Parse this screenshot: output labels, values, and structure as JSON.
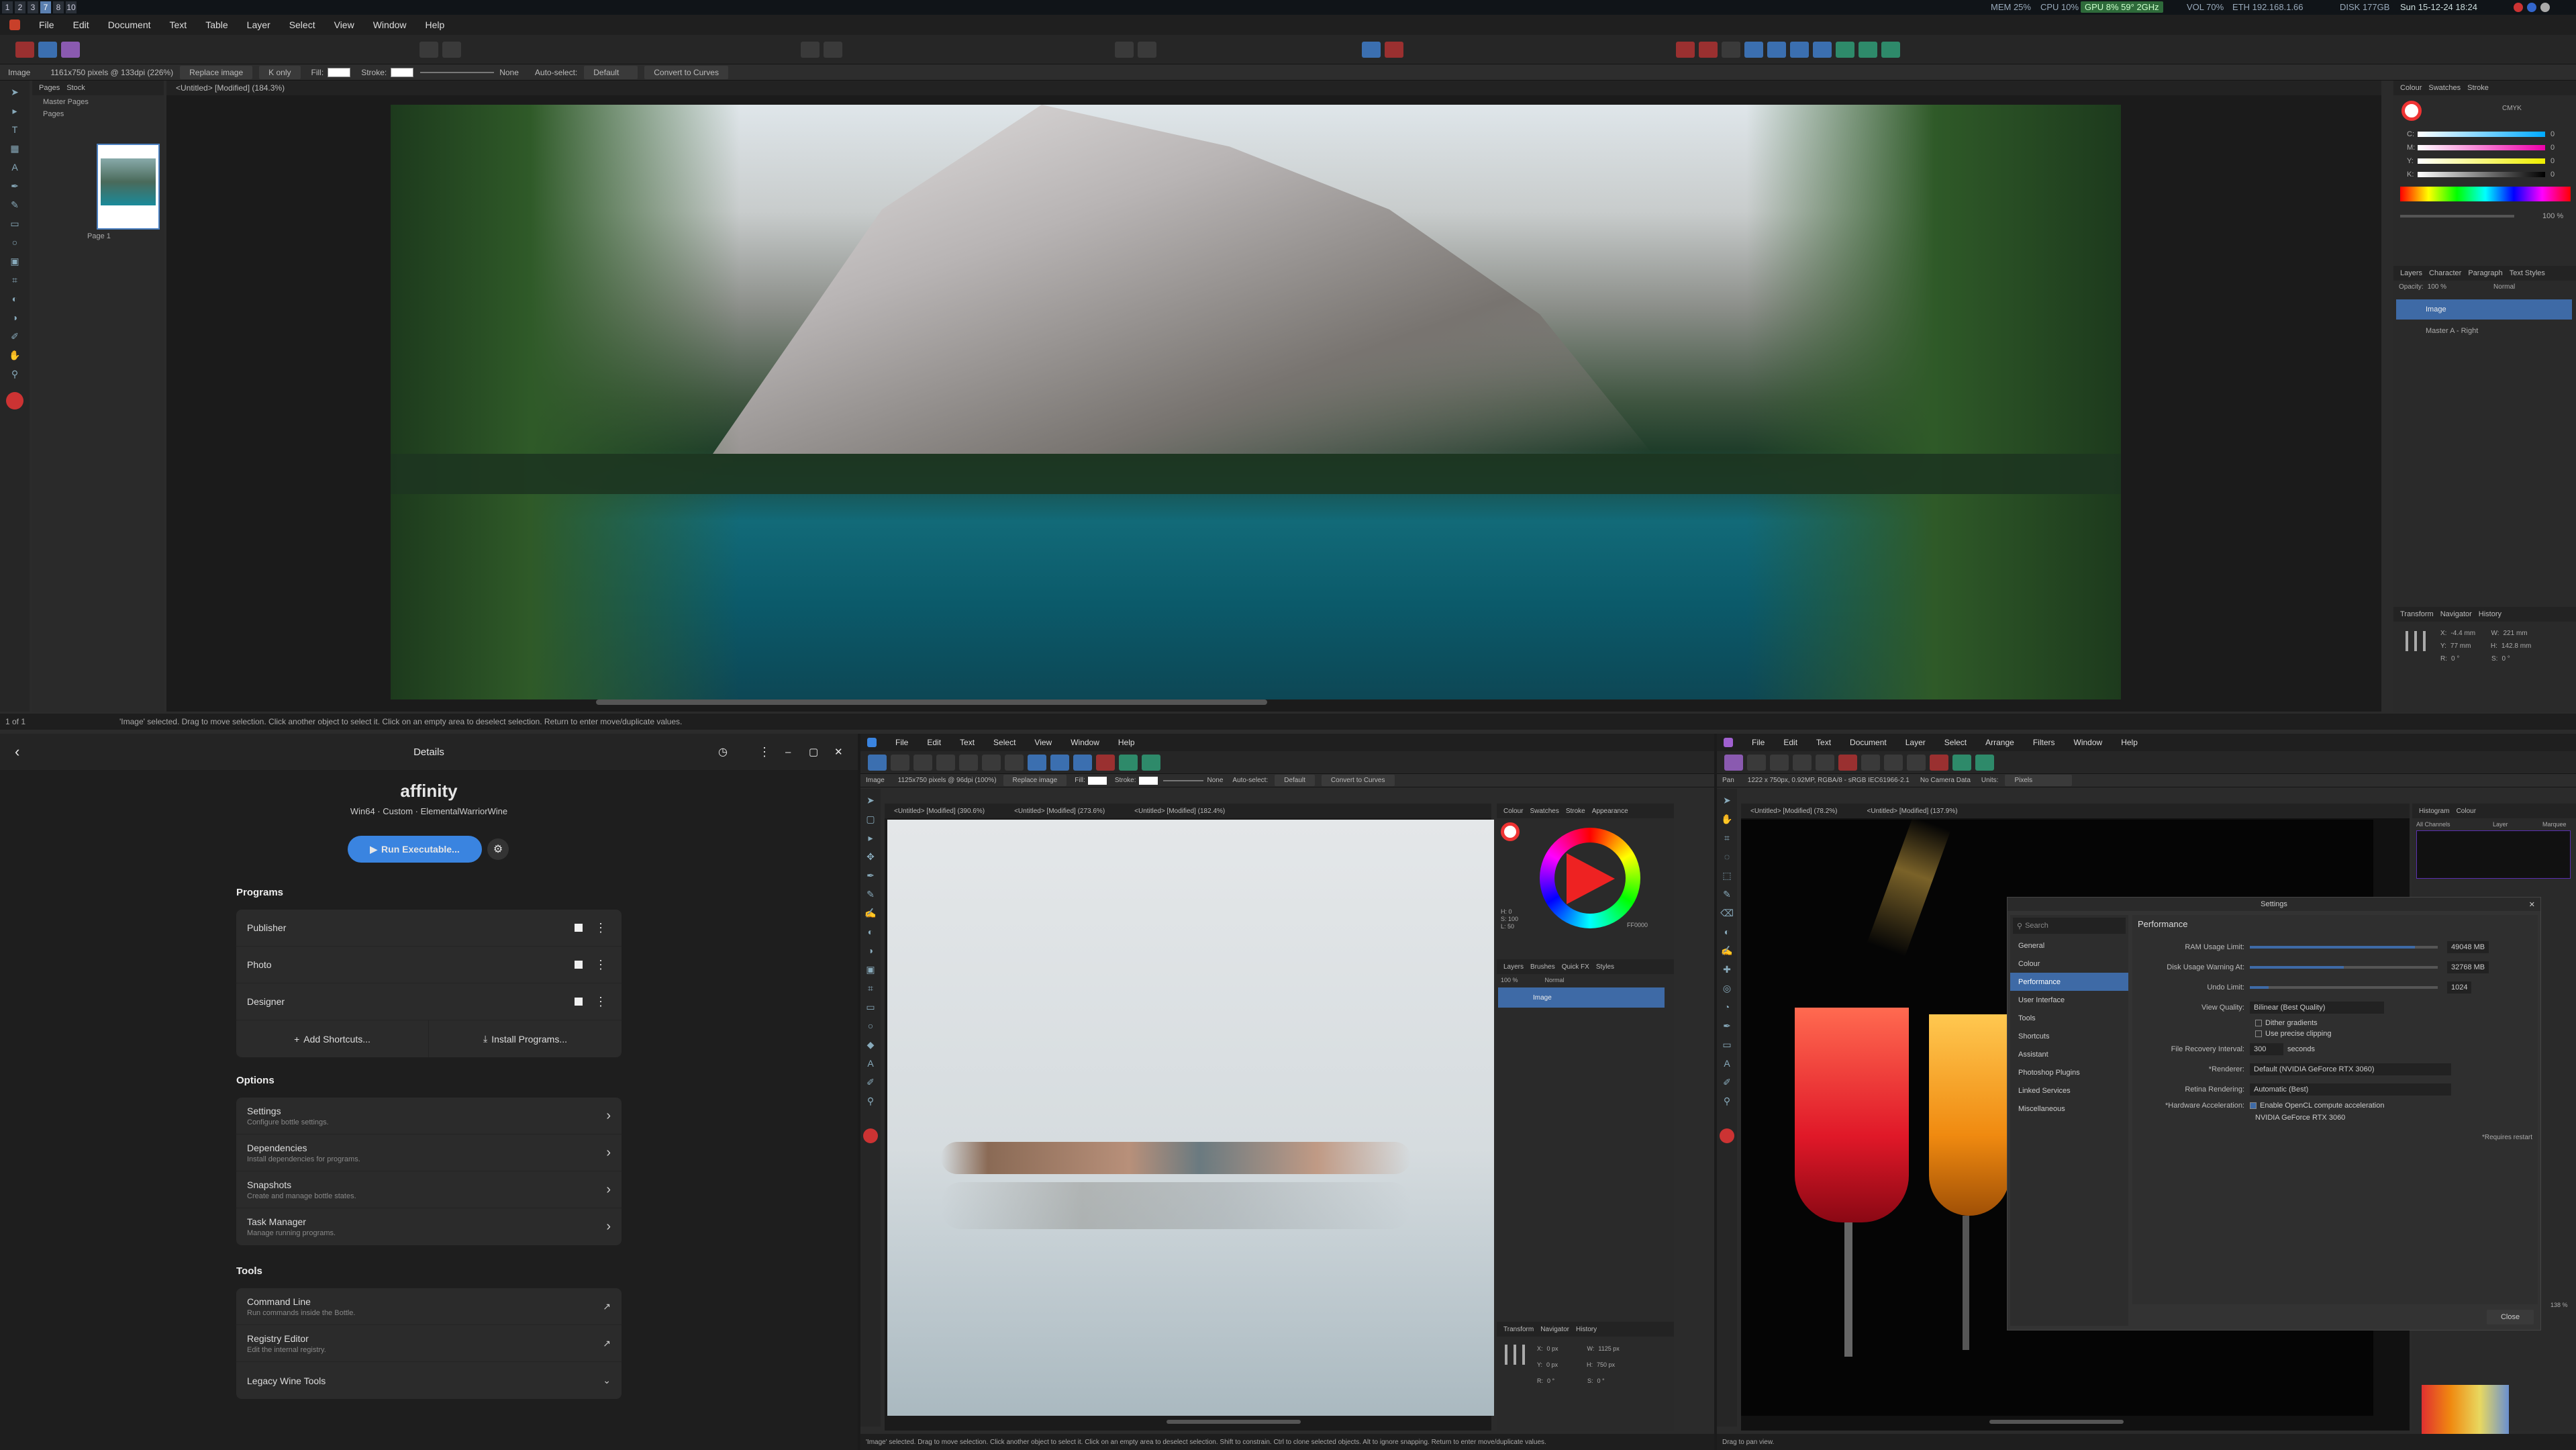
{
  "topbar": {
    "workspaces": [
      "1",
      "2",
      "3",
      "7",
      "8",
      "10"
    ],
    "mem": "MEM 25%",
    "cpu": "CPU 10%",
    "gpu": "GPU 8% 59° 2GHz",
    "vol": "VOL 70%",
    "eth": "ETH 192.168.1.66",
    "disk": "DISK 177GB",
    "clock": "Sun 15-12-24 18:24"
  },
  "win1": {
    "menu": [
      "File",
      "Edit",
      "Document",
      "Text",
      "Table",
      "Layer",
      "Select",
      "View",
      "Window",
      "Help"
    ],
    "ctx": {
      "label": "Image",
      "info": "1161x750 pixels @ 133dpi (226%)",
      "replace": "Replace image",
      "k": "K only",
      "fill": "Fill:",
      "stroke": "Stroke:",
      "none": "None",
      "autoselect": "Auto-select:",
      "default": "Default",
      "convert": "Convert to Curves"
    },
    "pages_tabs": [
      "Pages",
      "Stock"
    ],
    "master_pages": "Master Pages",
    "pages": "Pages",
    "page_label": "Page 1",
    "doc_tab": "<Untitled> [Modified] (184.3%)",
    "right_tabs": [
      "Colour",
      "Swatches",
      "Stroke"
    ],
    "colour_mode": "CMYK",
    "cmyk": [
      {
        "k": "C:",
        "v": "0"
      },
      {
        "k": "M:",
        "v": "0"
      },
      {
        "k": "Y:",
        "v": "0"
      },
      {
        "k": "K:",
        "v": "0"
      }
    ],
    "opacity_pct": "100 %",
    "layer_tabs": [
      "Layers",
      "Character",
      "Paragraph",
      "Text Styles"
    ],
    "layer_opacity_label": "Opacity:",
    "layer_opacity": "100 %",
    "layer_blend": "Normal",
    "layers": [
      {
        "name": "Image"
      },
      {
        "name": "Master A - Right"
      }
    ],
    "transform_tabs": [
      "Transform",
      "Navigator",
      "History"
    ],
    "transform": {
      "x": "-4.4 mm",
      "y": "77 mm",
      "w": "221 mm",
      "h": "142.8 mm",
      "r": "0 °",
      "s": "0 °"
    },
    "page_nav": "1 of 1",
    "status": "'Image' selected. Drag to move selection. Click another object to select it. Click on an empty area to deselect selection. Return to enter move/duplicate values."
  },
  "bottles": {
    "title": "Details",
    "app": "affinity",
    "subtitle": "Win64 · Custom · ElementalWarriorWine",
    "run": "Run Executable...",
    "programs_title": "Programs",
    "programs": [
      "Publisher",
      "Photo",
      "Designer"
    ],
    "add_shortcuts": "Add Shortcuts...",
    "install_programs": "Install Programs...",
    "options_title": "Options",
    "options": [
      {
        "title": "Settings",
        "sub": "Configure bottle settings."
      },
      {
        "title": "Dependencies",
        "sub": "Install dependencies for programs."
      },
      {
        "title": "Snapshots",
        "sub": "Create and manage bottle states."
      },
      {
        "title": "Task Manager",
        "sub": "Manage running programs."
      }
    ],
    "tools_title": "Tools",
    "tools": [
      {
        "title": "Command Line",
        "sub": "Run commands inside the Bottle."
      },
      {
        "title": "Registry Editor",
        "sub": "Edit the internal registry."
      },
      {
        "title": "Legacy Wine Tools",
        "sub": ""
      }
    ]
  },
  "win3": {
    "menu": [
      "File",
      "Edit",
      "Text",
      "Select",
      "View",
      "Window",
      "Help"
    ],
    "ctx": {
      "label": "Image",
      "info": "1125x750 pixels @ 96dpi (100%)",
      "replace": "Replace image",
      "fill": "Fill:",
      "stroke": "Stroke:",
      "none": "None",
      "autoselect": "Auto-select:",
      "default": "Default",
      "convert": "Convert to Curves"
    },
    "doc_tabs": [
      "<Untitled> [Modified] (390.6%)",
      "<Untitled> [Modified] (273.6%)",
      "<Untitled> [Modified] (182.4%)"
    ],
    "right_tabs": [
      "Colour",
      "Swatches",
      "Stroke",
      "Appearance"
    ],
    "hex": "FF0000",
    "hsl": [
      "H: 0",
      "S: 100",
      "L: 50"
    ],
    "layer_tabs": [
      "Layers",
      "Brushes",
      "Quick FX",
      "Styles"
    ],
    "layer_opacity": "100 %",
    "blend": "Normal",
    "layer_name": "Image",
    "transform_tabs": [
      "Transform",
      "Navigator",
      "History"
    ],
    "transform": {
      "x": "0 px",
      "y": "0 px",
      "w": "1125 px",
      "h": "750 px",
      "r": "0 °",
      "s": "0 °"
    },
    "status": "'Image' selected. Drag to move selection. Click another object to select it. Click on an empty area to deselect selection. Shift to constrain. Ctrl to clone selected objects. Alt to ignore snapping. Return to enter move/duplicate values."
  },
  "win4": {
    "menu": [
      "File",
      "Edit",
      "Text",
      "Document",
      "Layer",
      "Select",
      "Arrange",
      "Filters",
      "Window",
      "Help"
    ],
    "ctx": {
      "label": "Pan",
      "info": "1222 x 750px, 0.92MP, RGBA/8 - sRGB IEC61966-2.1",
      "camera": "No Camera Data",
      "units_label": "Units:",
      "units": "Pixels"
    },
    "doc_tabs": [
      "<Untitled> [Modified] (78.2%)",
      "<Untitled> [Modified] (137.9%)"
    ],
    "right_tabs": [
      "Histogram",
      "Colour"
    ],
    "channels": "All Channels",
    "layer_tab": "Layer",
    "marquee": "Marquee",
    "zoom": "138 %",
    "status": "Drag to pan view.",
    "settings": {
      "title": "Settings",
      "search": "Search",
      "nav": [
        "General",
        "Colour",
        "Performance",
        "User Interface",
        "Tools",
        "Shortcuts",
        "Assistant",
        "Photoshop Plugins",
        "Linked Services",
        "Miscellaneous"
      ],
      "selected": "Performance",
      "heading": "Performance",
      "ram_label": "RAM Usage Limit:",
      "ram": "49048 MB",
      "ram_fill": 0.88,
      "disk_label": "Disk Usage Warning At:",
      "disk": "32768 MB",
      "disk_fill": 0.5,
      "undo_label": "Undo Limit:",
      "undo": "1024",
      "undo_fill": 0.1,
      "view_label": "View Quality:",
      "view": "Bilinear (Best Quality)",
      "dither": "Dither gradients",
      "precise": "Use precise clipping",
      "recovery_label": "File Recovery Interval:",
      "recovery": "300",
      "seconds": "seconds",
      "renderer_label": "*Renderer:",
      "renderer": "Default (NVIDIA GeForce RTX 3060)",
      "retina_label": "Retina Rendering:",
      "retina": "Automatic (Best)",
      "hw_label": "*Hardware Acceleration:",
      "hw": "Enable OpenCL compute acceleration",
      "gpu": "NVIDIA GeForce RTX 3060",
      "restart": "*Requires restart",
      "close": "Close"
    }
  }
}
